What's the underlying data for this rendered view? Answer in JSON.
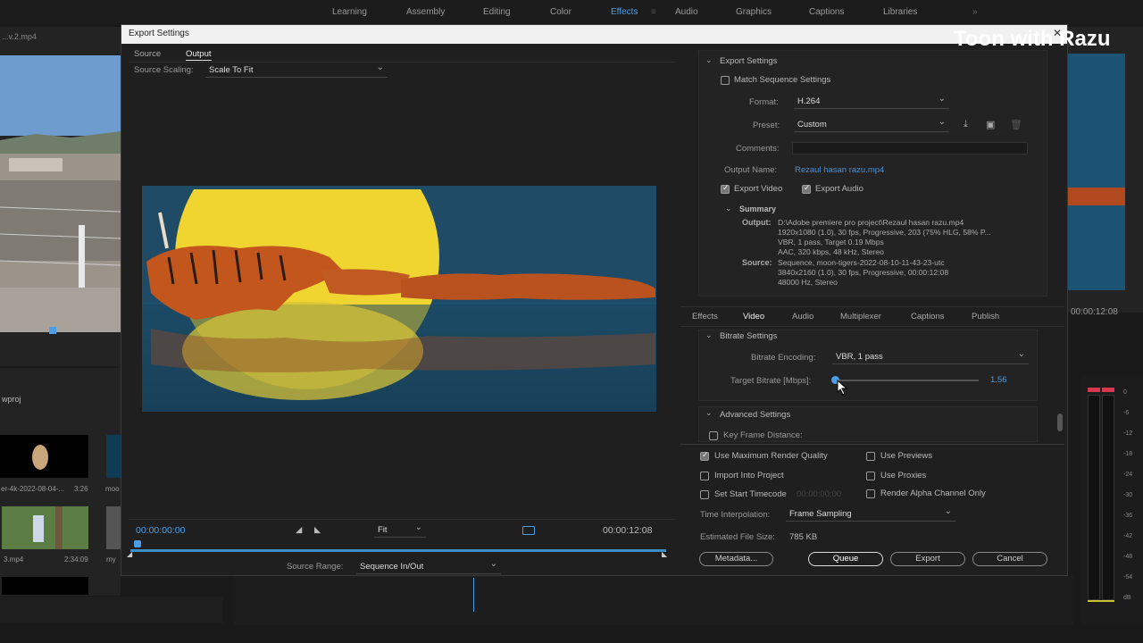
{
  "workspace_tabs": [
    "Learning",
    "Assembly",
    "Editing",
    "Color",
    "Effects",
    "Audio",
    "Graphics",
    "Captions",
    "Libraries"
  ],
  "workspace_active": "Effects",
  "watermark": "Toon with Razu",
  "background": {
    "sequence_tab": "...v.2.mp4",
    "timecode_right": "00:00:12:08",
    "project_label": "wproj",
    "thumb1_name": "er-4k-2022-08-04-...",
    "thumb1_duration": "3:26",
    "thumb1b_name": "moo",
    "thumb2_name": "3.mp4",
    "thumb2_duration": "2:34:09",
    "thumb2b_name": "my",
    "meter_labels": [
      "0",
      "-6",
      "-12",
      "-18",
      "-24",
      "-30",
      "-36",
      "-42",
      "-48",
      "-54",
      "dB"
    ]
  },
  "dialog": {
    "title": "Export Settings",
    "tabs": [
      "Source",
      "Output"
    ],
    "active_tab": "Output",
    "source_scaling_label": "Source Scaling:",
    "source_scaling_value": "Scale To Fit",
    "timecode_start": "00:00:00:00",
    "timecode_end": "00:00:12:08",
    "fit_value": "Fit",
    "source_range_label": "Source Range:",
    "source_range_value": "Sequence In/Out",
    "export_settings": {
      "heading": "Export Settings",
      "match_sequence_label": "Match Sequence Settings",
      "format_label": "Format:",
      "format_value": "H.264",
      "preset_label": "Preset:",
      "preset_value": "Custom",
      "comments_label": "Comments:",
      "output_name_label": "Output Name:",
      "output_name_value": "Rezaul hasan razu.mp4",
      "export_video_label": "Export Video",
      "export_audio_label": "Export Audio",
      "summary_heading": "Summary",
      "summary_output_label": "Output:",
      "summary_output_lines": [
        "D:\\Adobe premiere pro project\\Rezaul hasan razu.mp4",
        "1920x1080 (1.0), 30 fps, Progressive, 203 (75% HLG, 58% P...",
        "VBR, 1 pass, Target 0.19 Mbps",
        "AAC, 320 kbps, 48 kHz, Stereo"
      ],
      "summary_source_label": "Source:",
      "summary_source_lines": [
        "Sequence, moon-tigers-2022-08-10-11-43-23-utc",
        "3840x2160 (1.0), 30 fps, Progressive, 00:00:12:08",
        "48000 Hz, Stereo"
      ]
    },
    "settings_tabs": [
      "Effects",
      "Video",
      "Audio",
      "Multiplexer",
      "Captions",
      "Publish"
    ],
    "settings_active_tab": "Video",
    "bitrate": {
      "heading": "Bitrate Settings",
      "encoding_label": "Bitrate Encoding:",
      "encoding_value": "VBR, 1 pass",
      "target_label": "Target Bitrate [Mbps]:",
      "target_value": "1.56",
      "slider_fraction": 0.0
    },
    "advanced": {
      "heading": "Advanced Settings",
      "key_frame_label": "Key Frame Distance:"
    },
    "options": {
      "use_max_render_quality": "Use Maximum Render Quality",
      "use_previews": "Use Previews",
      "import_into_project": "Import Into Project",
      "use_proxies": "Use Proxies",
      "set_start_timecode": "Set Start Timecode",
      "start_timecode_value": "00:00:00:00",
      "render_alpha": "Render Alpha Channel Only",
      "time_interpolation_label": "Time Interpolation:",
      "time_interpolation_value": "Frame Sampling",
      "estimated_size_label": "Estimated File Size:",
      "estimated_size_value": "785 KB"
    },
    "buttons": {
      "metadata": "Metadata...",
      "queue": "Queue",
      "export": "Export",
      "cancel": "Cancel"
    }
  },
  "colors": {
    "accent_blue": "#4a9fe8",
    "link_blue": "#4d8fd4",
    "preview_bg": "#1f4b66",
    "moon": "#f0d531"
  }
}
